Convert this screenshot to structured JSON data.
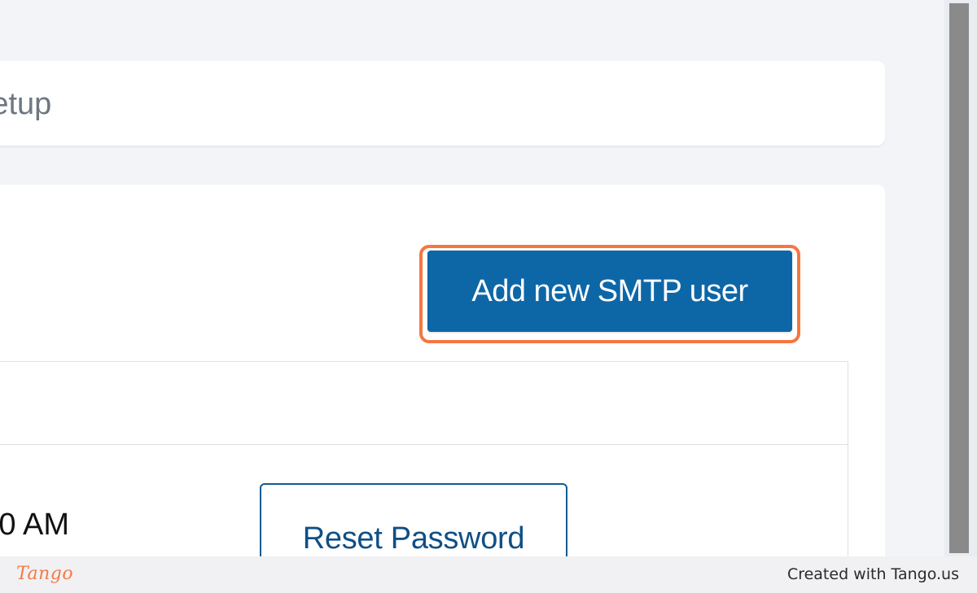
{
  "page": {
    "header_title": "SMTP Setup",
    "header_title_visible": "Setup"
  },
  "actions": {
    "add_button_label": "Add new SMTP user"
  },
  "table": {
    "rows": [
      {
        "time": "0 AM",
        "action_label": "Reset Password"
      }
    ]
  },
  "footer": {
    "logo_text": "Tango",
    "credit": "Created with Tango.us"
  },
  "colors": {
    "primary": "#0d67a7",
    "highlight": "#f5773f",
    "brand": "#f37a45"
  }
}
